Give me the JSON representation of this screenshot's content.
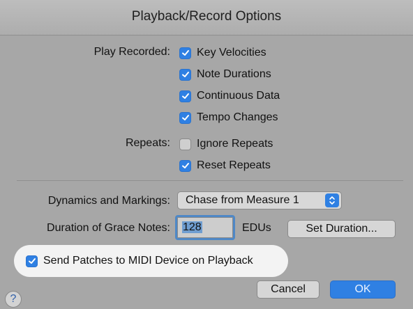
{
  "dialog": {
    "title": "Playback/Record Options",
    "play_recorded_label": "Play Recorded:",
    "play_recorded_options": [
      {
        "label": "Key Velocities",
        "checked": true
      },
      {
        "label": "Note Durations",
        "checked": true
      },
      {
        "label": "Continuous Data",
        "checked": true
      },
      {
        "label": "Tempo Changes",
        "checked": true
      }
    ],
    "repeats_label": "Repeats:",
    "repeats_options": [
      {
        "label": "Ignore Repeats",
        "checked": false
      },
      {
        "label": "Reset Repeats",
        "checked": true
      }
    ],
    "dynamics_label": "Dynamics and Markings:",
    "dynamics_value": "Chase from Measure 1",
    "grace_label": "Duration of Grace Notes:",
    "grace_value": "128",
    "grace_unit": "EDUs",
    "set_duration_button": "Set Duration...",
    "send_patches_label": "Send Patches to MIDI Device on Playback",
    "send_patches_checked": true,
    "cancel_button": "Cancel",
    "ok_button": "OK",
    "help_button": "?",
    "colors": {
      "accent": "#2f80e3",
      "background": "#a7a7a7",
      "highlight": "#f3f3f3"
    }
  }
}
